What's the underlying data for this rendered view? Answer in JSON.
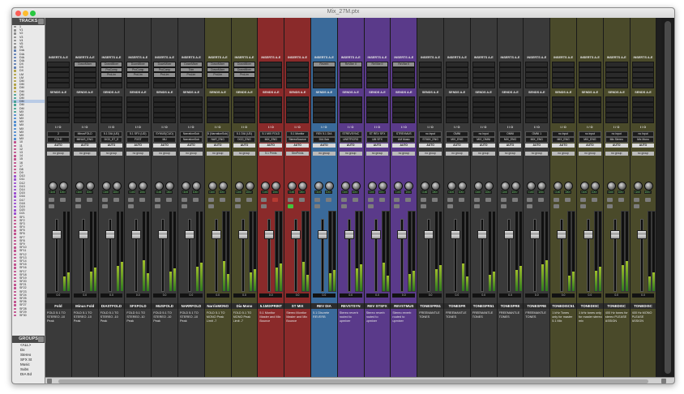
{
  "window": {
    "title": "Mix_27M.ptx",
    "traffic_colors": [
      "#fc5f57",
      "#fdbc2e",
      "#28c840"
    ]
  },
  "tracks_panel": {
    "header": "TRACKS",
    "items": [
      {
        "n": "1",
        "c": "#8a8a8a"
      },
      {
        "n": "V1",
        "c": "#8a8a8a"
      },
      {
        "n": "V2",
        "c": "#8a8a8a"
      },
      {
        "n": "V3",
        "c": "#8a8a8a"
      },
      {
        "n": "V4",
        "c": "#8a8a8a"
      },
      {
        "n": "V5",
        "c": "#8a8a8a"
      },
      {
        "n": "V6",
        "c": "#8a8a8a"
      },
      {
        "n": "DIA",
        "c": "#5a7ab0"
      },
      {
        "n": "DIA",
        "c": "#5a7ab0"
      },
      {
        "n": "DIA",
        "c": "#5a7ab0"
      },
      {
        "n": "DIA",
        "c": "#5a7ab0"
      },
      {
        "n": "DX",
        "c": "#5a7ab0"
      },
      {
        "n": "DX",
        "c": "#5a7ab0"
      },
      {
        "n": "DX",
        "c": "#b0a040"
      },
      {
        "n": "LM",
        "c": "#b0a040"
      },
      {
        "n": "LM",
        "c": "#b0a040"
      },
      {
        "n": "DM",
        "c": "#b0a040"
      },
      {
        "n": "DM",
        "c": "#b0a040"
      },
      {
        "n": "DM",
        "c": "#b0a040"
      },
      {
        "n": "DM",
        "c": "#b0a040"
      },
      {
        "n": "DM",
        "c": "#40a090"
      },
      {
        "n": "DM",
        "c": "#40a090"
      },
      {
        "n": "DM",
        "c": "#40a090"
      },
      {
        "n": "DM",
        "c": "#40a090"
      },
      {
        "n": "DM",
        "c": "#40a090"
      },
      {
        "n": "MX",
        "c": "#40a090"
      },
      {
        "n": "MX",
        "c": "#4a8ad0"
      },
      {
        "n": "MX",
        "c": "#4a8ad0"
      },
      {
        "n": "MX",
        "c": "#4a8ad0"
      },
      {
        "n": "MX",
        "c": "#4a8ad0"
      },
      {
        "n": "MX",
        "c": "#4a8ad0"
      },
      {
        "n": "MX",
        "c": "#4a8ad0"
      },
      {
        "n": "MX",
        "c": "#4a8ad0"
      },
      {
        "n": "MX",
        "c": "#4a8ad0"
      },
      {
        "n": "10",
        "c": "#c04a8a"
      },
      {
        "n": "11",
        "c": "#c04a8a"
      },
      {
        "n": "12",
        "c": "#c04a8a"
      },
      {
        "n": "13",
        "c": "#c04a8a"
      },
      {
        "n": "14",
        "c": "#c04a8a"
      },
      {
        "n": "15",
        "c": "#c04a8a"
      },
      {
        "n": "16",
        "c": "#c04a8a"
      },
      {
        "n": "17",
        "c": "#c04a8a"
      },
      {
        "n": "D8",
        "c": "#c04a8a"
      },
      {
        "n": "D9",
        "c": "#c04a8a"
      },
      {
        "n": "D10",
        "c": "#9a4ad0"
      },
      {
        "n": "D11",
        "c": "#9a4ad0"
      },
      {
        "n": "D12",
        "c": "#9a4ad0"
      },
      {
        "n": "D13",
        "c": "#9a4ad0"
      },
      {
        "n": "D14",
        "c": "#9a4ad0"
      },
      {
        "n": "D15",
        "c": "#9a4ad0"
      },
      {
        "n": "D16",
        "c": "#9a4ad0"
      },
      {
        "n": "D17",
        "c": "#9a4ad0"
      },
      {
        "n": "D18",
        "c": "#9a4ad0"
      },
      {
        "n": "D19",
        "c": "#9a4ad0"
      },
      {
        "n": "D20",
        "c": "#9a4ad0"
      },
      {
        "n": "D21",
        "c": "#9a4ad0"
      },
      {
        "n": "SF1",
        "c": "#c04a8a"
      },
      {
        "n": "SF2",
        "c": "#c04a8a"
      },
      {
        "n": "SF3",
        "c": "#c04a8a"
      },
      {
        "n": "SF4",
        "c": "#c04a8a"
      },
      {
        "n": "SF5",
        "c": "#c04a8a"
      },
      {
        "n": "SF6",
        "c": "#c04a8a"
      },
      {
        "n": "SF7",
        "c": "#c04a8a"
      },
      {
        "n": "SF8",
        "c": "#c04a8a"
      },
      {
        "n": "SF9",
        "c": "#c04a8a"
      },
      {
        "n": "SF10",
        "c": "#c04a8a"
      },
      {
        "n": "SF11",
        "c": "#c04a8a"
      },
      {
        "n": "SF12",
        "c": "#c04a8a"
      },
      {
        "n": "SF13",
        "c": "#c04a8a"
      },
      {
        "n": "SF14",
        "c": "#c04a8a"
      },
      {
        "n": "SF15",
        "c": "#c04a8a"
      },
      {
        "n": "SF16",
        "c": "#c04a8a"
      },
      {
        "n": "SF17",
        "c": "#c04a8a"
      },
      {
        "n": "SF18",
        "c": "#c04a8a"
      },
      {
        "n": "SF19",
        "c": "#c04a8a"
      },
      {
        "n": "SF20",
        "c": "#c04a8a"
      },
      {
        "n": "SF21",
        "c": "#c04a8a"
      },
      {
        "n": "SF22",
        "c": "#c04a8a"
      },
      {
        "n": "SF23",
        "c": "#c04a8a"
      },
      {
        "n": "SF24",
        "c": "#c04a8a"
      },
      {
        "n": "SF25",
        "c": "#c04a8a"
      },
      {
        "n": "SF26",
        "c": "#c04a8a"
      },
      {
        "n": "SF27",
        "c": "#c04a8a"
      },
      {
        "n": "SF28",
        "c": "#c04a8a"
      },
      {
        "n": "SF29",
        "c": "#c04a8a"
      },
      {
        "n": "SF30",
        "c": "#c04a8a"
      }
    ]
  },
  "groups_panel": {
    "header": "GROUPS",
    "items": [
      "<ALL>",
      "Dx",
      "Stereo",
      "SFX St",
      "Music",
      "Subs",
      "DIA Ed"
    ]
  },
  "mixer": {
    "inserts_label": "INSERTS A-E",
    "sends_label": "SENDS A-E",
    "io_label": "I / O",
    "strips": [
      {
        "name": "Fold",
        "color": "#3a3a3a",
        "ins": [
          "",
          "",
          ""
        ],
        "in": "2",
        "out": "FOLD",
        "auto": "AUTO",
        "group": "no group",
        "vol": "0.0",
        "comment": "FOLD 5.1 TO STEREO -10 Peak"
      },
      {
        "name": "Minus Fold",
        "color": "#3a3a3a",
        "ins": [
          "DownMixer",
          "",
          ""
        ],
        "in": "MinusFOLD",
        "out": "MINUS_ENG",
        "auto": "AUTO",
        "group": "no group",
        "vol": "0.0",
        "comment": "FOLD 5.1 TO STEREO -10 Peak"
      },
      {
        "name": "DIASTFOLD",
        "color": "#3a3a3a",
        "ins": [
          "DownMixer",
          "ProComp",
          "ProLim"
        ],
        "in": "5.1 DIA (UD)",
        "out": "DCD_ST_E",
        "auto": "AUTO",
        "group": "no group",
        "vol": "0.0",
        "comment": "FOLD 5.1 TO STEREO -10 Peak"
      },
      {
        "name": "SFXFOLD",
        "color": "#3a3a3a",
        "ins": [
          "DownMixer",
          "ProComp",
          "ProLim"
        ],
        "in": "5.1 SFX (UD)",
        "out": "FXST",
        "auto": "AUTO",
        "group": "no group",
        "vol": "0.0",
        "comment": "FOLD 5.1 TO STEREO -10 Peak"
      },
      {
        "name": "MUSFOLD",
        "color": "#3a3a3a",
        "ins": [
          "DownMixer",
          "ProComp",
          "ProLim"
        ],
        "in": "SYMUS(CUD)",
        "out": "MU",
        "auto": "AUTO",
        "group": "no group",
        "vol": "0.0",
        "comment": "FOLD 5.1 TO STEREO -10 Peak"
      },
      {
        "name": "NARRFOLD",
        "color": "#3a3a3a",
        "ins": [
          "DownMixer",
          "Trim",
          "ProLim"
        ],
        "in": "NarrationSub",
        "out": "NarrationSub",
        "auto": "AUTO",
        "group": "no group",
        "vol": "0.0",
        "comment": "FOLD 5.1 TO STEREO -10 Peak"
      },
      {
        "name": "NarrinMONO",
        "color": "#4a4a2a",
        "ins": [
          "DownMixer",
          "DownMixer",
          "ProLim"
        ],
        "in": "5 (NarrationSub)",
        "out": "NAR_ENG",
        "auto": "AUTO",
        "group": "no group",
        "vol": "0.0",
        "comment": "FOLD 5.1 TO MONO Peak Limit -7"
      },
      {
        "name": "Dia Mono",
        "color": "#4a4a2a",
        "ins": [
          "DownMixer",
          "DownMixer",
          "ProLim"
        ],
        "in": "5.1 DIA (UD)",
        "out": "DCD_ENG",
        "auto": "AUTO",
        "group": "no group",
        "vol": "0.0",
        "comment": "FOLD 5.1 TO MONO Peak Limit -7"
      },
      {
        "name": "5.1MIXPRINT",
        "color": "#8a2a2a",
        "ins": [
          "",
          "",
          ""
        ],
        "in": "5.1 MIX FOLD",
        "out": "MIX_ENG",
        "auto": "AUTO",
        "group": "5.1 Prints",
        "vol": "0.0",
        "comment": "5.1 Monitor Master and Mix Bounce"
      },
      {
        "name": "ST MIX",
        "color": "#8a2a2a",
        "ins": [
          "",
          "",
          ""
        ],
        "in": "5.1 Monitor",
        "out": "StereoBounce",
        "auto": "AUTO",
        "group": "StmPrints",
        "vol": "0.0",
        "comment": "Stereo Monitor Master and Mix Bounce"
      },
      {
        "name": "REV DIA",
        "color": "#3a6a9a",
        "ins": [
          "Reverb",
          "",
          ""
        ],
        "in": "REV 5.1 DIA",
        "out": "DIA Sub",
        "auto": "AUTO",
        "group": "no group",
        "vol": "0.0",
        "comment": "5.1 Discrete REVERB"
      },
      {
        "name": "REVSTSYN",
        "color": "#5a3a8a",
        "ins": [
          "ReVibe II",
          "",
          ""
        ],
        "in": "STREVSYNC",
        "out": "UNSTRCRG",
        "auto": "AUTO",
        "group": "no group",
        "vol": "0.0",
        "comment": "Stereo reverb routed to upmixer"
      },
      {
        "name": "REV STSFX",
        "color": "#5a3a8a",
        "ins": [
          "ReVibe II",
          "",
          ""
        ],
        "in": "ST REV SFX",
        "out": "UM SFX",
        "auto": "AUTO",
        "group": "no group",
        "vol": "0.0",
        "comment": "Stereo reverb routed to upmixer"
      },
      {
        "name": "REVSTMUS",
        "color": "#5a3a8a",
        "ins": [
          "ReVibe II",
          "",
          ""
        ],
        "in": "STREVMUS",
        "out": "UM Music",
        "auto": "AUTO",
        "group": "no group",
        "vol": "0.0",
        "comment": "Stereo reverb routed to upmixer"
      },
      {
        "name": "TONESFR51",
        "color": "#3a3a3a",
        "ins": [
          "",
          "",
          ""
        ],
        "in": "no input",
        "out": "STMIX_ENG",
        "auto": "AUTO",
        "group": "no group",
        "vol": "0.0",
        "comment": "FREEMANTLE TONES"
      },
      {
        "name": "TONESFR",
        "color": "#3a3a3a",
        "ins": [
          "",
          "",
          ""
        ],
        "in": "OMNI",
        "out": "MIX_ENG",
        "auto": "AUTO",
        "group": "no group",
        "vol": "0.0",
        "comment": "FREEMANTLE TONES"
      },
      {
        "name": "TONESFR51",
        "color": "#3a3a3a",
        "ins": [
          "",
          "",
          ""
        ],
        "in": "no input",
        "out": "MIX_OMNI",
        "auto": "AUTO",
        "group": "no group",
        "vol": "0.0",
        "comment": "FREEMANTLE TONES"
      },
      {
        "name": "TONESFRE",
        "color": "#3a3a3a",
        "ins": [
          "",
          "",
          ""
        ],
        "in": "OMNI",
        "out": "MIX_ENG",
        "auto": "AUTO",
        "group": "no group",
        "vol": "0.0",
        "comment": "FREEMANTLE TONES"
      },
      {
        "name": "TONESFRE",
        "color": "#3a3a3a",
        "ins": [
          "",
          "",
          ""
        ],
        "in": "OMNI 1",
        "out": "MIX_ENG",
        "auto": "AUTO",
        "group": "no group",
        "vol": "0.0",
        "comment": "FREEMANTLE TONES"
      },
      {
        "name": "TONEDISC51",
        "color": "#4a4a2a",
        "ins": [
          "",
          "",
          ""
        ],
        "in": "no input",
        "out": "MIX_ENG",
        "auto": "AUTO",
        "group": "no group",
        "vol": "0.0",
        "comment": "1 kHz Tones only for master 5.1 Mix"
      },
      {
        "name": "TONEDISC",
        "color": "#4a4a2a",
        "ins": [
          "",
          "",
          ""
        ],
        "in": "no input",
        "out": "MIX_ENG",
        "auto": "AUTO",
        "group": "no group",
        "vol": "0.0",
        "comment": "1 kHz tones only for master stereo mix"
      },
      {
        "name": "TONEDISC",
        "color": "#4a4a2a",
        "ins": [
          "",
          "",
          ""
        ],
        "in": "no input",
        "out": "Mix Stereo",
        "auto": "AUTO",
        "group": "no group",
        "vol": "0.0",
        "comment": "400 Hz tones for stereo PLEASE ASSIGN"
      },
      {
        "name": "TONEDISC",
        "color": "#4a4a2a",
        "ins": [
          "",
          "",
          ""
        ],
        "in": "no input",
        "out": "Mix Mono",
        "auto": "AUTO",
        "group": "no group",
        "vol": "0.0",
        "comment": "400 Hz MONO PLEASE ASSIGN"
      }
    ]
  }
}
